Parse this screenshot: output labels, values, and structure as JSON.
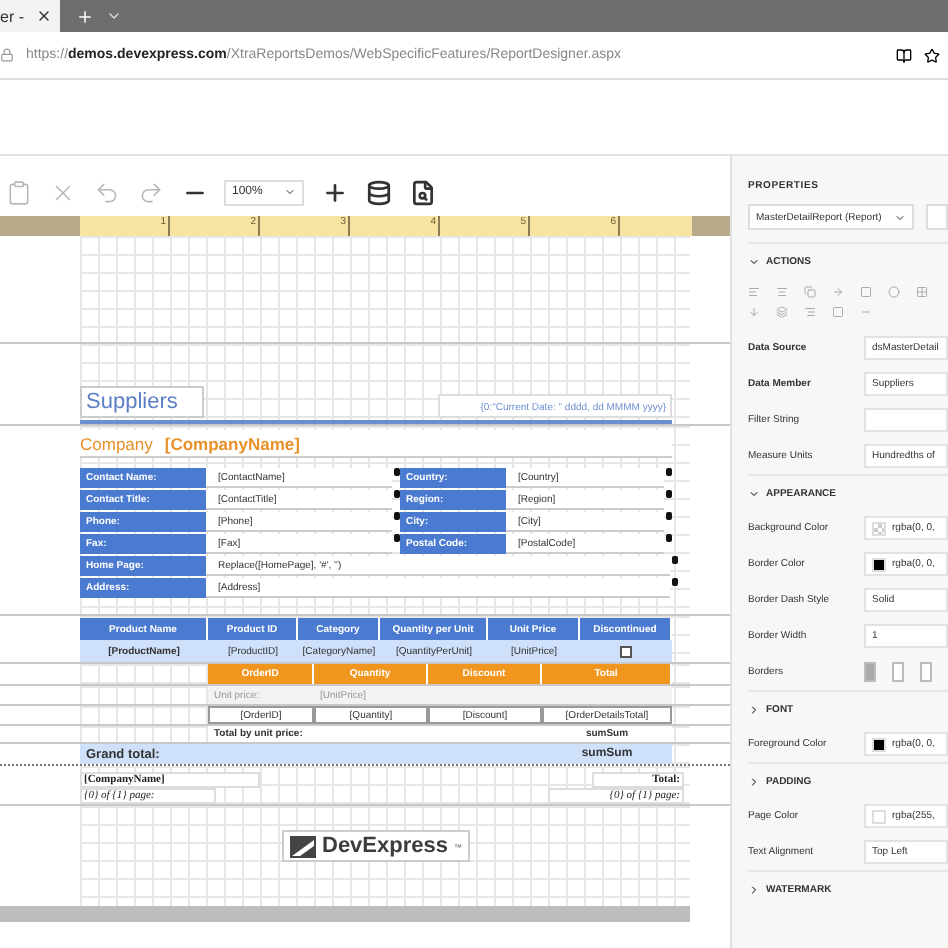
{
  "browser": {
    "tab_title": "er -",
    "address": "https://**demos.devexpress.com**/XtraReportsDemos/WebSpecificFeatures/ReportDesigner.aspx"
  },
  "toolbar": {
    "buttons": [
      {
        "kind": "paste",
        "disabled": true
      },
      {
        "kind": "delete",
        "disabled": true
      },
      {
        "kind": "undo",
        "disabled": true
      },
      {
        "kind": "redo",
        "disabled": true
      },
      {
        "kind": "zoom-out",
        "disabled": false
      },
      {
        "kind": "zoom"
      },
      {
        "kind": "zoom-in",
        "disabled": false
      },
      {
        "kind": "data-source",
        "disabled": false
      },
      {
        "kind": "preview",
        "disabled": false
      }
    ],
    "zoom": "100%"
  },
  "ruler": {
    "marks": [
      "1",
      "2",
      "3",
      "4",
      "5",
      "6"
    ]
  },
  "report": {
    "title": "Suppliers",
    "date_expression": "{0:\"Current Date: \" dddd, dd MMMM yyyy}",
    "company_label": "Company",
    "company_field": "[CompanyName]",
    "contacts": [
      {
        "label": "Contact Name:",
        "value": "[ContactName]",
        "label_2": "Country:",
        "value_2": "[Country]"
      },
      {
        "label": "Contact Title:",
        "value": "[ContactTitle]",
        "label_2": "Region:",
        "value_2": "[Region]"
      },
      {
        "label": "Phone:",
        "value": "[Phone]",
        "label_2": "City:",
        "value_2": "[City]"
      },
      {
        "label": "Fax:",
        "value": "[Fax]",
        "label_2": "Postal Code:",
        "value_2": "[PostalCode]"
      },
      {
        "label": "Home Page:",
        "value": "Replace([HomePage], '#', '')"
      },
      {
        "label": "Address:",
        "value": "[Address]"
      }
    ],
    "product_columns": [
      "Product Name",
      "Product ID",
      "Category",
      "Quantity per Unit",
      "Unit Price",
      "Discontinued"
    ],
    "product_cells": [
      "[ProductName]",
      "[ProductID]",
      "[CategoryName]",
      "[QuantityPerUnit]",
      "[UnitPrice]"
    ],
    "order_columns": [
      "OrderID",
      "Quantity",
      "Discount",
      "Total"
    ],
    "unit_price_label": "Unit price:",
    "unit_price_field": "[UnitPrice]",
    "order_cells": [
      "[OrderID]",
      "[Quantity]",
      "[Discount]",
      "[OrderDetailsTotal]"
    ],
    "total_label": "Total by unit price:",
    "total_value": "sumSum",
    "grand_total_label": "Grand total:",
    "grand_total_value": "sumSum",
    "footer": {
      "company": "[CompanyName]",
      "pages": "{0} of {1} page:",
      "total": "Total:",
      "pages_2": "{0} of {1} page:"
    },
    "logo": {
      "name": "DevExpress",
      "mark": "™"
    }
  },
  "properties": {
    "title": "PROPERTIES",
    "selector": "MasterDetailReport (Report)",
    "items": [
      {
        "kind": "section",
        "label": "ACTIONS",
        "expanded": true
      },
      {
        "kind": "actions"
      },
      {
        "kind": "text",
        "label": "Data Source",
        "value": "dsMasterDetail",
        "emphasized": true
      },
      {
        "kind": "text",
        "label": "Data Member",
        "value": "Suppliers",
        "emphasized": true
      },
      {
        "kind": "text",
        "label": "Filter String",
        "emphasized": false
      },
      {
        "kind": "text",
        "label": "Measure Units",
        "value": "Hundredths of",
        "emphasized": false
      },
      {
        "kind": "section",
        "label": "APPEARANCE",
        "expanded": true
      },
      {
        "kind": "color",
        "label": "Background Color",
        "value": "rgba(0, 0,"
      },
      {
        "kind": "color",
        "label": "Border Color",
        "value": "rgba(0, 0,",
        "color": "#000000"
      },
      {
        "kind": "text",
        "label": "Border Dash Style",
        "value": "Solid",
        "emphasized": false
      },
      {
        "kind": "text",
        "label": "Border Width",
        "value": "1",
        "emphasized": false
      },
      {
        "kind": "borders",
        "label": "Borders",
        "options": [
          {
            "selected": true
          },
          {
            "selected": false
          },
          {
            "selected": false
          }
        ]
      },
      {
        "kind": "section",
        "label": "FONT",
        "expanded": false
      },
      {
        "kind": "color",
        "label": "Foreground Color",
        "value": "rgba(0, 0,",
        "color": "#000000"
      },
      {
        "kind": "section",
        "label": "PADDING",
        "expanded": false
      },
      {
        "kind": "color",
        "label": "Page Color",
        "value": "rgba(255,",
        "color": "#ffffff"
      },
      {
        "kind": "text",
        "label": "Text Alignment",
        "value": "Top Left",
        "emphasized": false
      },
      {
        "kind": "section",
        "label": "WATERMARK",
        "expanded": false
      }
    ]
  }
}
